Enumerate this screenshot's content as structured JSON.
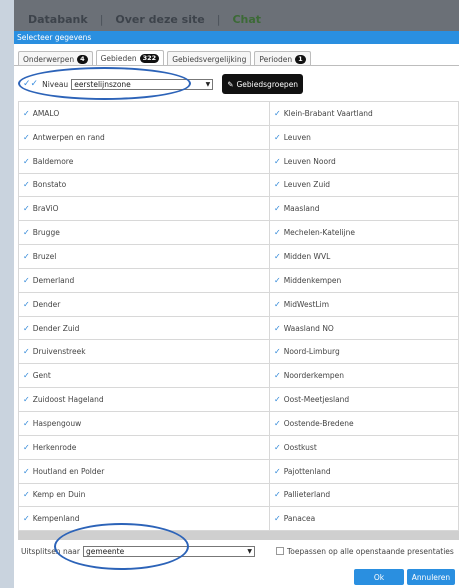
{
  "topnav": {
    "databank": "Databank",
    "over": "Over deze site",
    "chat": "Chat",
    "separator": "|"
  },
  "dialog": {
    "title": "Selecteer gegevens"
  },
  "tabs": [
    {
      "label": "Onderwerpen",
      "count": "4"
    },
    {
      "label": "Gebieden",
      "count": "322"
    },
    {
      "label": "Gebiedsvergelijking",
      "count": ""
    },
    {
      "label": "Perioden",
      "count": "1"
    }
  ],
  "level": {
    "label": "Niveau",
    "value": "eerstelijnszone",
    "groups_button": "Gebiedsgroepen"
  },
  "areas": [
    [
      "AMALO",
      "Klein-Brabant Vaartland"
    ],
    [
      "Antwerpen en rand",
      "Leuven"
    ],
    [
      "Baldemore",
      "Leuven Noord"
    ],
    [
      "Bonstato",
      "Leuven Zuid"
    ],
    [
      "BraViO",
      "Maasland"
    ],
    [
      "Brugge",
      "Mechelen-Katelijne"
    ],
    [
      "Bruzel",
      "Midden WVL"
    ],
    [
      "Demerland",
      "Middenkempen"
    ],
    [
      "Dender",
      "MidWestLim"
    ],
    [
      "Dender Zuid",
      "Waasland NO"
    ],
    [
      "Druivenstreek",
      "Noord-Limburg"
    ],
    [
      "Gent",
      "Noorderkempen"
    ],
    [
      "Zuidoost Hageland",
      "Oost-Meetjesland"
    ],
    [
      "Haspengouw",
      "Oostende-Bredene"
    ],
    [
      "Herkenrode",
      "Oostkust"
    ],
    [
      "Houtland en Polder",
      "Pajottenland"
    ],
    [
      "Kemp en Duin",
      "Pallieterland"
    ],
    [
      "Kempenland",
      "Panacea"
    ]
  ],
  "bottom": {
    "split_label": "Uitsplitsen naar",
    "split_value": "gemeente",
    "apply_label": "Toepassen op alle openstaande presentaties"
  },
  "actions": {
    "ok": "Ok",
    "cancel": "Annuleren"
  },
  "colors": {
    "accent": "#2a8fe0",
    "annotation": "#2c63b8"
  }
}
